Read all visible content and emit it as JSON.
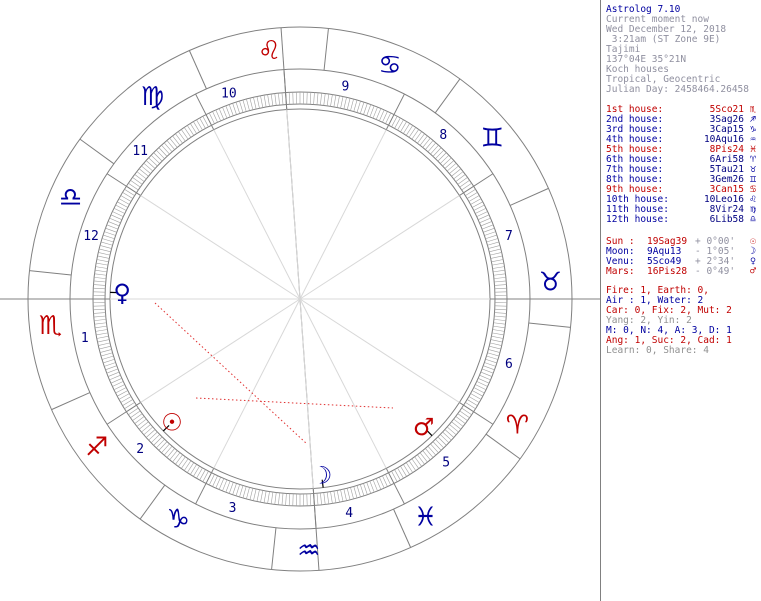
{
  "header": {
    "lines": [
      "Astrolog 7.10",
      "Current moment now",
      "Wed December 12, 2018",
      " 3:21am (ST Zone 9E)",
      "Tajimi",
      "137°04E 35°21N",
      "Koch houses",
      "Tropical, Geocentric",
      "Julian Day: 2458464.26458"
    ]
  },
  "houses": [
    {
      "label": "1st house:",
      "value": "5Sco21",
      "glyph": "♏",
      "color": "#c00000"
    },
    {
      "label": "2nd house:",
      "value": "3Sag26",
      "glyph": "♐",
      "color": "#0000a0"
    },
    {
      "label": "3rd house:",
      "value": "3Cap15",
      "glyph": "♑",
      "color": "#0000a0"
    },
    {
      "label": "4th house:",
      "value": "10Aqu16",
      "glyph": "♒",
      "color": "#0000a0"
    },
    {
      "label": "5th house:",
      "value": "8Pis24",
      "glyph": "♓",
      "color": "#c00000"
    },
    {
      "label": "6th house:",
      "value": "6Ari58",
      "glyph": "♈",
      "color": "#0000a0"
    },
    {
      "label": "7th house:",
      "value": "5Tau21",
      "glyph": "♉",
      "color": "#0000a0"
    },
    {
      "label": "8th house:",
      "value": "3Gem26",
      "glyph": "♊",
      "color": "#0000a0"
    },
    {
      "label": "9th house:",
      "value": "3Can15",
      "glyph": "♋",
      "color": "#c00000"
    },
    {
      "label": "10th house:",
      "value": "10Leo16",
      "glyph": "♌",
      "color": "#0000a0"
    },
    {
      "label": "11th house:",
      "value": "8Vir24",
      "glyph": "♍",
      "color": "#0000a0"
    },
    {
      "label": "12th house:",
      "value": "6Lib58",
      "glyph": "♎",
      "color": "#0000a0"
    }
  ],
  "planets": [
    {
      "name": "Sun",
      "label": "Sun :",
      "position": "19Sag39",
      "lat": "+ 0°00'",
      "glyph": "☉",
      "color": "#c00000"
    },
    {
      "name": "Moon",
      "label": "Moon:",
      "position": "9Aqu13",
      "lat": "- 1°05'",
      "glyph": "☽",
      "color": "#0000a0"
    },
    {
      "name": "Venus",
      "label": "Venu:",
      "position": "5Sco49",
      "lat": "+ 2°34'",
      "glyph": "♀",
      "color": "#0000a0"
    },
    {
      "name": "Mars",
      "label": "Mars:",
      "position": "16Pis28",
      "lat": "- 0°49'",
      "glyph": "♂",
      "color": "#c00000"
    }
  ],
  "elements": [
    {
      "text": "Fire: 1, Earth: 0,",
      "color": "#c00000"
    },
    {
      "text": "Air : 1, Water: 2",
      "color": "#0000a0"
    },
    {
      "text": "Car: 0, Fix: 2, Mut: 2",
      "color": "#c00000"
    },
    {
      "text": "Yang: 2, Yin: 2",
      "color": "#909090"
    },
    {
      "text": "M: 0, N: 4, A: 3, D: 1",
      "color": "#0000a0"
    },
    {
      "text": "Ang: 1, Suc: 2, Cad: 1",
      "color": "#c00000"
    },
    {
      "text": "Learn: 0, Share: 4",
      "color": "#909090"
    }
  ],
  "wheel": {
    "sign_glyphs": [
      {
        "glyph": "♌",
        "angle": 97,
        "color": "#c00000"
      },
      {
        "glyph": "♋",
        "angle": 69,
        "color": "#0000a0"
      },
      {
        "glyph": "♊",
        "angle": 40,
        "color": "#0000a0"
      },
      {
        "glyph": "♉",
        "angle": 4,
        "color": "#0000a0"
      },
      {
        "glyph": "♈",
        "angle": -30,
        "color": "#c00000"
      },
      {
        "glyph": "♓",
        "angle": -60,
        "color": "#0000a0"
      },
      {
        "glyph": "♒",
        "angle": -88,
        "color": "#0000a0"
      },
      {
        "glyph": "♑",
        "angle": -119,
        "color": "#0000a0"
      },
      {
        "glyph": "♐",
        "angle": -144,
        "color": "#c00000"
      },
      {
        "glyph": "♏",
        "angle": -174,
        "color": "#c00000"
      },
      {
        "glyph": "♎",
        "angle": 156,
        "color": "#0000a0"
      },
      {
        "glyph": "♍",
        "angle": 126,
        "color": "#0000a0"
      }
    ],
    "house_numbers": [
      {
        "label": "10",
        "angle": 109
      },
      {
        "label": "9",
        "angle": 78
      },
      {
        "label": "8",
        "angle": 49
      },
      {
        "label": "7",
        "angle": 17
      },
      {
        "label": "6",
        "angle": -17
      },
      {
        "label": "5",
        "angle": -48
      },
      {
        "label": "4",
        "angle": -77
      },
      {
        "label": "3",
        "angle": -108
      },
      {
        "label": "2",
        "angle": -137
      },
      {
        "label": "1",
        "angle": -170
      },
      {
        "label": "12",
        "angle": 163
      },
      {
        "label": "11",
        "angle": 137
      }
    ],
    "planet_glyphs": [
      {
        "name": "Venus",
        "glyph": "♀",
        "angle": 178,
        "color": "#0000a0"
      },
      {
        "name": "Sun",
        "glyph": "☉",
        "angle": -136,
        "color": "#c00000"
      },
      {
        "name": "Moon",
        "glyph": "☽",
        "angle": -83,
        "color": "#0000a0"
      },
      {
        "name": "Mars",
        "glyph": "♂",
        "angle": -46,
        "color": "#c00000"
      }
    ]
  }
}
